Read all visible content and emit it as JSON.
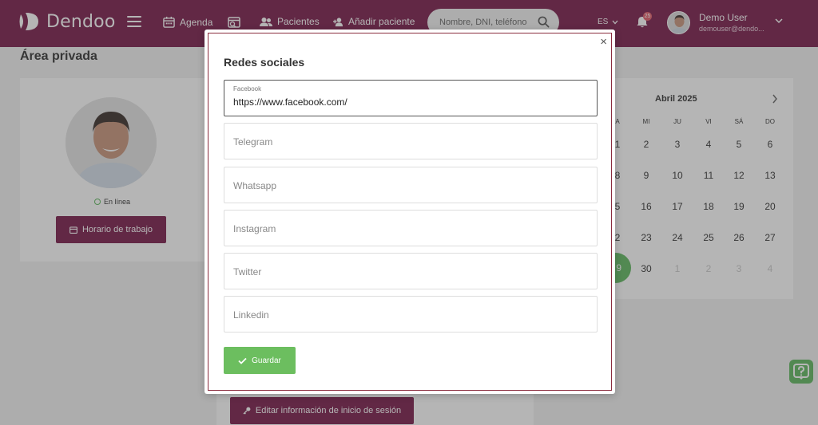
{
  "header": {
    "brand": "Dendoo",
    "nav": {
      "agenda": "Agenda",
      "pacientes": "Pacientes",
      "add_patient": "Añadir paciente"
    },
    "search_placeholder": "Nombre, DNI, teléfono",
    "language": "ES",
    "notifications_count": "25",
    "user_name": "Demo User",
    "user_email": "demouser@dendo...",
    "brand_color": "#7a1c4b"
  },
  "page": {
    "title": "Área privada",
    "status": "En línea",
    "work_schedule_button": "Horario de trabajo",
    "edit_login_button": "Editar información de inicio de sesión"
  },
  "calendar": {
    "month": "Abril 2025",
    "weekdays": [
      "A",
      "MI",
      "JU",
      "VI",
      "SÁ",
      "DO"
    ],
    "rows": [
      [
        "1",
        "2",
        "3",
        "4",
        "5",
        "6"
      ],
      [
        "8",
        "9",
        "10",
        "11",
        "12",
        "13"
      ],
      [
        "5",
        "16",
        "17",
        "18",
        "19",
        "20"
      ],
      [
        "2",
        "23",
        "24",
        "25",
        "26",
        "27"
      ],
      [
        "9",
        "30",
        "1",
        "2",
        "3",
        "4"
      ]
    ],
    "today": "9",
    "accent": "#5fb85f"
  },
  "modal": {
    "title": "Redes sociales",
    "close": "×",
    "fields": {
      "facebook_label": "Facebook",
      "facebook_value": "https://www.facebook.com/",
      "telegram": "Telegram",
      "whatsapp": "Whatsapp",
      "instagram": "Instagram",
      "twitter": "Twitter",
      "linkedin": "Linkedin"
    },
    "save_button": "Guardar",
    "save_color": "#6cbe5f"
  }
}
